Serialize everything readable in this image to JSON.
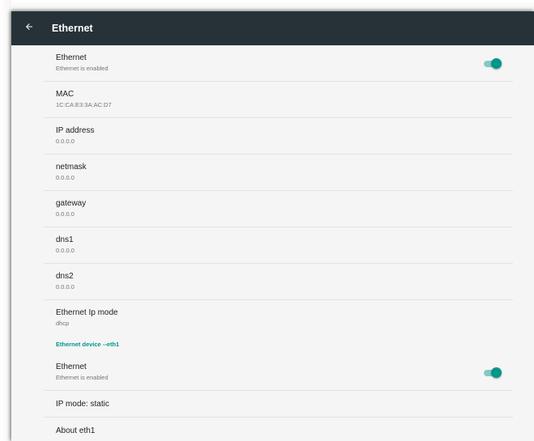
{
  "toolbar": {
    "title": "Ethernet",
    "back_icon": "arrow-back-icon"
  },
  "colors": {
    "toolbar_bg": "#263238",
    "accent": "#009688",
    "background": "#f5f5f5"
  },
  "ethernet": {
    "title": "Ethernet",
    "summary": "Ethernet is enabled",
    "enabled": true
  },
  "mac": {
    "title": "MAC",
    "value": "1C:CA:E3:3A:AC:D7"
  },
  "ip_address": {
    "title": "IP address",
    "value": "0.0.0.0"
  },
  "netmask": {
    "title": "netmask",
    "value": "0.0.0.0"
  },
  "gateway": {
    "title": "gateway",
    "value": "0.0.0.0"
  },
  "dns1": {
    "title": "dns1",
    "value": "0.0.0.0"
  },
  "dns2": {
    "title": "dns2",
    "value": "0.0.0.0"
  },
  "ip_mode": {
    "title": "Ethernet Ip mode",
    "value": "dhcp"
  },
  "eth1_section": {
    "header": "Ethernet device --eth1",
    "ethernet": {
      "title": "Ethernet",
      "summary": "Ethernet is enabled",
      "enabled": true
    },
    "ip_mode_label": "IP mode: static",
    "about_label": "About eth1"
  }
}
